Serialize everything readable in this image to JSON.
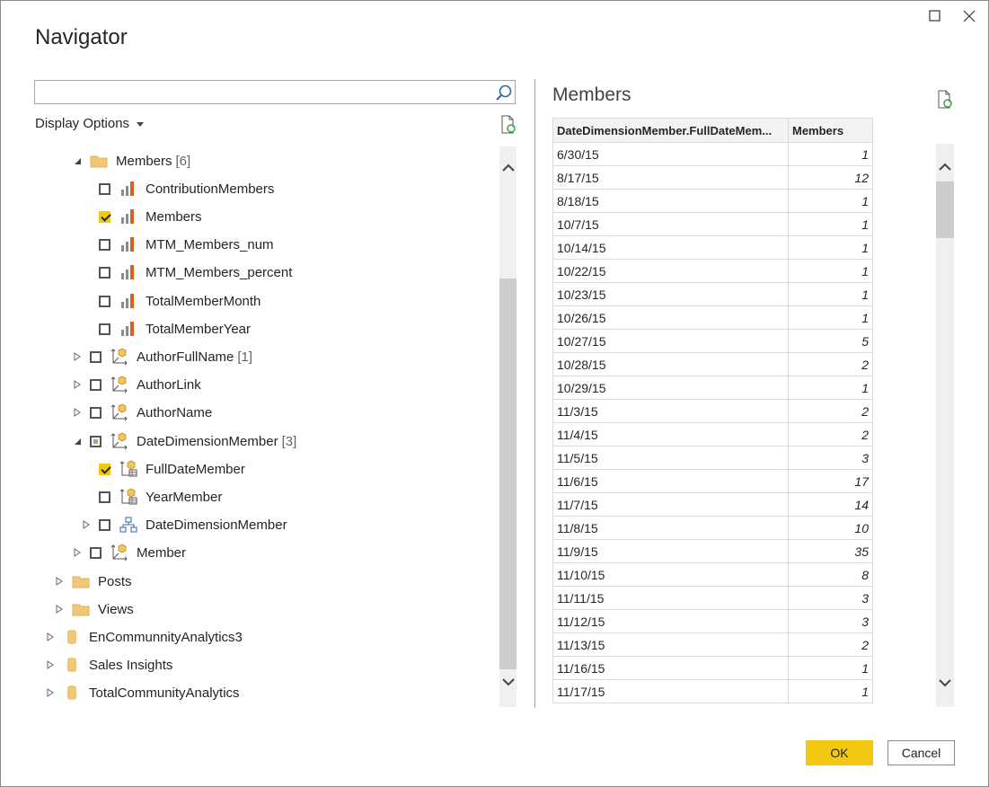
{
  "window": {
    "title": "Navigator"
  },
  "search": {
    "value": "",
    "placeholder": ""
  },
  "display_options": {
    "label": "Display Options"
  },
  "tree": [
    {
      "label": "Members",
      "count": "[6]",
      "icon": "folder-icon",
      "check": "none",
      "expander": "expanded"
    },
    {
      "label": "ContributionMembers",
      "count": "",
      "icon": "bar-chart-icon",
      "check": "unchecked",
      "expander": "none"
    },
    {
      "label": "Members",
      "count": "",
      "icon": "bar-chart-icon",
      "check": "checked",
      "expander": "none"
    },
    {
      "label": "MTM_Members_num",
      "count": "",
      "icon": "bar-chart-icon",
      "check": "unchecked",
      "expander": "none"
    },
    {
      "label": "MTM_Members_percent",
      "count": "",
      "icon": "bar-chart-icon",
      "check": "unchecked",
      "expander": "none"
    },
    {
      "label": "TotalMemberMonth",
      "count": "",
      "icon": "bar-chart-icon",
      "check": "unchecked",
      "expander": "none"
    },
    {
      "label": "TotalMemberYear",
      "count": "",
      "icon": "bar-chart-icon",
      "check": "unchecked",
      "expander": "none"
    },
    {
      "label": "AuthorFullName",
      "count": "[1]",
      "icon": "dimension-icon",
      "check": "unchecked",
      "expander": "collapsed"
    },
    {
      "label": "AuthorLink",
      "count": "",
      "icon": "dimension-icon",
      "check": "unchecked",
      "expander": "collapsed"
    },
    {
      "label": "AuthorName",
      "count": "",
      "icon": "dimension-icon",
      "check": "unchecked",
      "expander": "collapsed"
    },
    {
      "label": "DateDimensionMember",
      "count": "[3]",
      "icon": "dimension-icon",
      "check": "partial",
      "expander": "expanded"
    },
    {
      "label": "FullDateMember",
      "count": "",
      "icon": "dimension-table-icon",
      "check": "checked",
      "expander": "none"
    },
    {
      "label": "YearMember",
      "count": "",
      "icon": "dimension-table-icon",
      "check": "unchecked",
      "expander": "none"
    },
    {
      "label": "DateDimensionMember",
      "count": "",
      "icon": "hierarchy-icon",
      "check": "unchecked",
      "expander": "collapsed"
    },
    {
      "label": "Member",
      "count": "",
      "icon": "dimension-icon",
      "check": "unchecked",
      "expander": "collapsed"
    },
    {
      "label": "Posts",
      "count": "",
      "icon": "folder-icon",
      "check": "none",
      "expander": "collapsed"
    },
    {
      "label": "Views",
      "count": "",
      "icon": "folder-icon",
      "check": "none",
      "expander": "collapsed"
    },
    {
      "label": "EnCommunnityAnalytics3",
      "count": "",
      "icon": "database-icon",
      "check": "none",
      "expander": "collapsed"
    },
    {
      "label": "Sales Insights",
      "count": "",
      "icon": "database-icon",
      "check": "none",
      "expander": "collapsed"
    },
    {
      "label": "TotalCommunityAnalytics",
      "count": "",
      "icon": "database-icon",
      "check": "none",
      "expander": "collapsed"
    }
  ],
  "preview": {
    "title": "Members",
    "columns": [
      "DateDimensionMember.FullDateMem...",
      "Members"
    ],
    "rows": [
      [
        "6/30/15",
        "1"
      ],
      [
        "8/17/15",
        "12"
      ],
      [
        "8/18/15",
        "1"
      ],
      [
        "10/7/15",
        "1"
      ],
      [
        "10/14/15",
        "1"
      ],
      [
        "10/22/15",
        "1"
      ],
      [
        "10/23/15",
        "1"
      ],
      [
        "10/26/15",
        "1"
      ],
      [
        "10/27/15",
        "5"
      ],
      [
        "10/28/15",
        "2"
      ],
      [
        "10/29/15",
        "1"
      ],
      [
        "11/3/15",
        "2"
      ],
      [
        "11/4/15",
        "2"
      ],
      [
        "11/5/15",
        "3"
      ],
      [
        "11/6/15",
        "17"
      ],
      [
        "11/7/15",
        "14"
      ],
      [
        "11/8/15",
        "10"
      ],
      [
        "11/9/15",
        "35"
      ],
      [
        "11/10/15",
        "8"
      ],
      [
        "11/11/15",
        "3"
      ],
      [
        "11/12/15",
        "3"
      ],
      [
        "11/13/15",
        "2"
      ],
      [
        "11/16/15",
        "1"
      ],
      [
        "11/17/15",
        "1"
      ]
    ]
  },
  "buttons": {
    "ok": "OK",
    "cancel": "Cancel"
  },
  "colors": {
    "accent": "#f2c811",
    "bar_icon": "#d9631e",
    "folder": "#f0c777"
  }
}
